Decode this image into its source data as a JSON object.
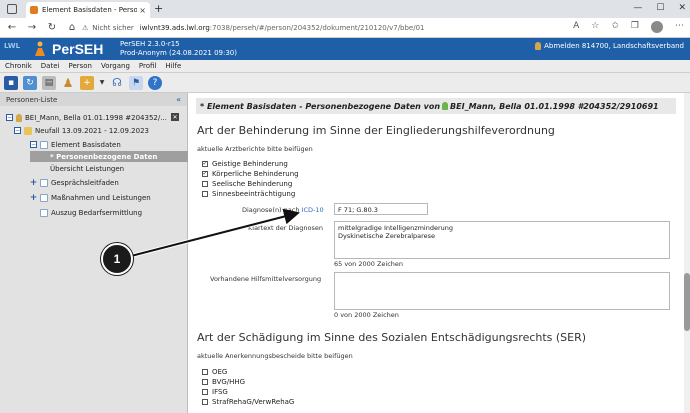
{
  "browser": {
    "tab_title": "Element Basisdaten - Personenbe",
    "tab_close": "×",
    "new_tab": "+",
    "security_warning": "⚠",
    "not_secure": "Nicht sicher",
    "url_host": "iwlvnt39.ads.lwl.org",
    "url_path": ":7038/perseh/#/person/204352/dokument/210120/v7/bbe/01",
    "back": "←",
    "forward": "→",
    "reload": "↻",
    "home": "⌂",
    "minimize": "—",
    "maximize": "☐",
    "close": "✕"
  },
  "app": {
    "logo_small": "LWL",
    "name": "PerSEH",
    "version": "PerSEH 2.3.0-r15",
    "environment": "Prod-Anonym (24.08.2021 09:30)",
    "logout_label": "Abmelden 814700, Landschaftsverband"
  },
  "menu": [
    "Chronik",
    "Datei",
    "Person",
    "Vorgang",
    "Profil",
    "Hilfe"
  ],
  "sidebar": {
    "title": "Personen-Liste",
    "collapse": "«",
    "items": [
      {
        "label": "BEI_Mann, Bella 01.01.1998 #204352/..."
      },
      {
        "label": "Neufall 13.09.2021 - 12.09.2023"
      },
      {
        "label": "Element Basisdaten"
      },
      {
        "label": "* Personenbezogene Daten"
      },
      {
        "label": "Übersicht Leistungen"
      },
      {
        "label": "Gesprächsleitfaden"
      },
      {
        "label": "Maßnahmen und Leistungen"
      },
      {
        "label": "Auszug Bedarfsermittlung"
      }
    ]
  },
  "main": {
    "title_prefix": "* Element Basisdaten - Personenbezogene Daten von",
    "title_person": "BEI_Mann, Bella 01.01.1998 #204352/2910691",
    "section1": {
      "heading": "Art der Behinderung im Sinne der Eingliederungshilfeverordnung",
      "note": "aktuelle Arztberichte bitte beifügen",
      "checkboxes": [
        {
          "label": "Geistige Behinderung",
          "checked": true
        },
        {
          "label": "Körperliche Behinderung",
          "checked": true
        },
        {
          "label": "Seelische Behinderung",
          "checked": false
        },
        {
          "label": "Sinnesbeeinträchtigung",
          "checked": false
        }
      ],
      "diagnosis_label": "Diagnose(n) nach",
      "diagnosis_link": "ICD-10",
      "diagnosis_value": "F 71; G.80.3",
      "klartext_label": "Klartext der Diagnosen",
      "klartext_value": "mittelgradige Intelligenzminderung\nDyskinetische Zerebralparese",
      "klartext_count": "65 von 2000 Zeichen",
      "hilfsmittel_label": "Vorhandene Hilfsmittelversorgung",
      "hilfsmittel_value": "",
      "hilfsmittel_count": "0 von 2000 Zeichen"
    },
    "section2": {
      "heading": "Art der Schädigung im Sinne des Sozialen Entschädigungsrechts (SER)",
      "note": "aktuelle Anerkennungsbescheide bitte beifügen",
      "checkboxes": [
        {
          "label": "OEG",
          "checked": false
        },
        {
          "label": "BVG/HHG",
          "checked": false
        },
        {
          "label": "IFSG",
          "checked": false
        },
        {
          "label": "StrafRehaG/VerwRehaG",
          "checked": false
        }
      ]
    }
  },
  "callout": {
    "number": "1"
  },
  "colors": {
    "header_blue": "#1f5fa8",
    "link_blue": "#2a6cc0"
  }
}
